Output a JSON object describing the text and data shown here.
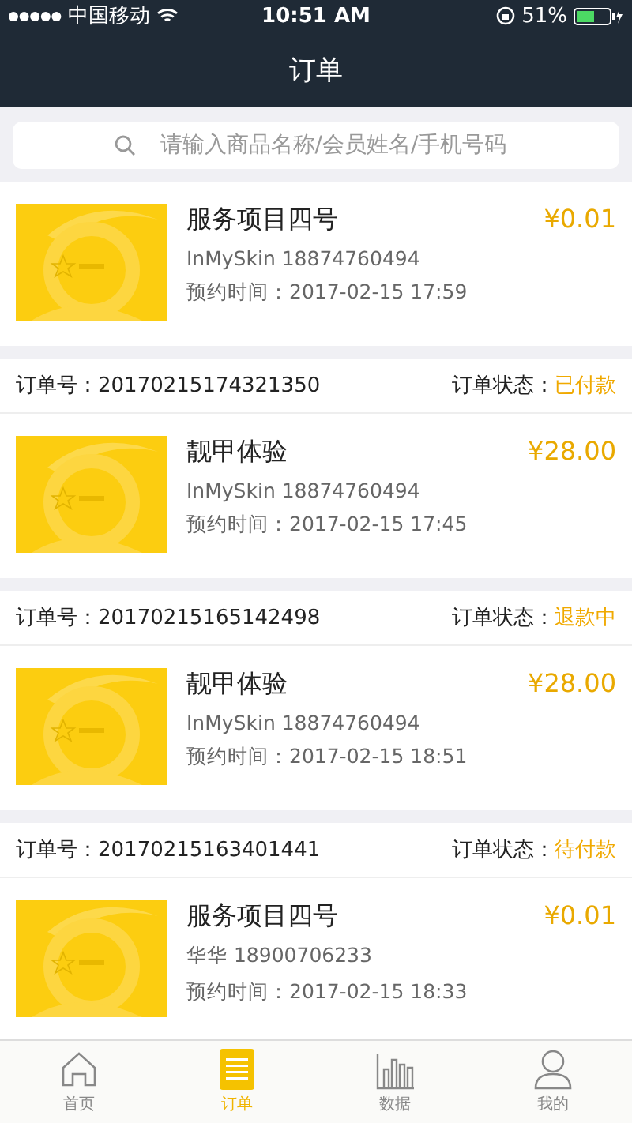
{
  "status_bar": {
    "carrier": "中国移动",
    "time": "10:51 AM",
    "battery": "51%"
  },
  "nav": {
    "title": "订单"
  },
  "search": {
    "placeholder": "请输入商品名称/会员姓名/手机号码"
  },
  "orders": [
    {
      "title": "服务项目四号",
      "price": "¥0.01",
      "customer": "InMySkin 18874760494",
      "time": "预约时间：2017-02-15 17:59"
    },
    {
      "order_label": "订单号：",
      "order_no": "20170215174321350",
      "status_label": "订单状态：",
      "status": "已付款",
      "title": "靓甲体验",
      "price": "¥28.00",
      "customer": "InMySkin 18874760494",
      "time": "预约时间：2017-02-15 17:45"
    },
    {
      "order_label": "订单号：",
      "order_no": "20170215165142498",
      "status_label": "订单状态：",
      "status": "退款中",
      "title": "靓甲体验",
      "price": "¥28.00",
      "customer": "InMySkin 18874760494",
      "time": "预约时间：2017-02-15 18:51"
    },
    {
      "order_label": "订单号：",
      "order_no": "20170215163401441",
      "status_label": "订单状态：",
      "status": "待付款",
      "title": "服务项目四号",
      "price": "¥0.01",
      "customer": "华华 18900706233",
      "time": "预约时间：2017-02-15 18:33"
    }
  ],
  "tabs": [
    {
      "kind": "home",
      "label": "首页",
      "selected": false
    },
    {
      "kind": "orders",
      "label": "订单",
      "selected": true
    },
    {
      "kind": "data",
      "label": "数据",
      "selected": false
    },
    {
      "kind": "me",
      "label": "我的",
      "selected": false
    }
  ]
}
